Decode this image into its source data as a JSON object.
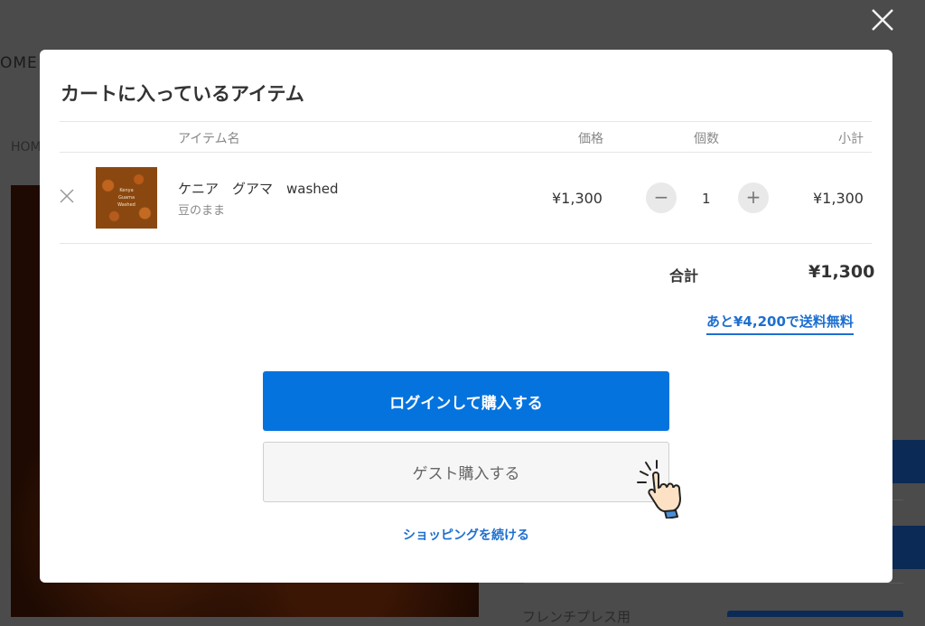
{
  "background": {
    "nav_label": "OME",
    "breadcrumb": "HOM",
    "bottom_text": "フレンチプレス用",
    "close_icon": "close-icon"
  },
  "cart": {
    "title": "カートに入っているアイテム",
    "columns": {
      "item": "アイテム名",
      "price": "価格",
      "quantity": "個数",
      "subtotal": "小計"
    },
    "items": [
      {
        "name": "ケニア　グアマ　washed",
        "variant": "豆のまま",
        "price": "¥1,300",
        "quantity": "1",
        "subtotal": "¥1,300",
        "thumbnail_text": [
          "Kenya",
          "Guama",
          "Washed"
        ]
      }
    ],
    "total_label": "合計",
    "total_value": "¥1,300",
    "free_shipping_notice": "あと¥4,200で送料無料",
    "login_button": "ログインして購入する",
    "guest_button": "ゲスト購入する",
    "continue_link": "ショッピングを続ける"
  },
  "colors": {
    "accent": "#0573de",
    "link": "#1d6fd0",
    "overlay": "#4b4b4b"
  },
  "icons": {
    "remove": "close-icon",
    "decrement": "minus-icon",
    "increment": "plus-icon",
    "cursor": "hand-pointer-icon"
  }
}
